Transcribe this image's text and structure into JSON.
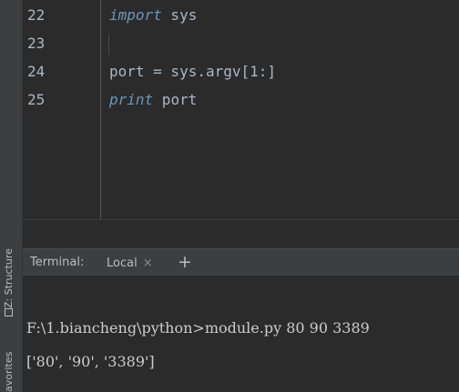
{
  "sidebar": {
    "structure_label": "Z: Structure",
    "favorites_label": "avorites"
  },
  "editor": {
    "lines": [
      {
        "number": "22",
        "keyword": "import",
        "rest": " sys"
      },
      {
        "number": "23",
        "keyword": "",
        "rest": ""
      },
      {
        "number": "24",
        "keyword": "",
        "rest": "port = sys.argv[1:]"
      },
      {
        "number": "25",
        "keyword": "print",
        "rest": " port"
      }
    ]
  },
  "terminal": {
    "title": "Terminal:",
    "tab_label": "Local",
    "close_glyph": "×",
    "add_glyph": "+",
    "output": [
      "F:\\1.biancheng\\python>module.py 80 90 3389",
      "['80', '90', '3389']"
    ]
  },
  "colors": {
    "background": "#2b2b2b",
    "panel": "#3c3f41",
    "keyword": "#cc7832",
    "text": "#a9b7c6"
  }
}
